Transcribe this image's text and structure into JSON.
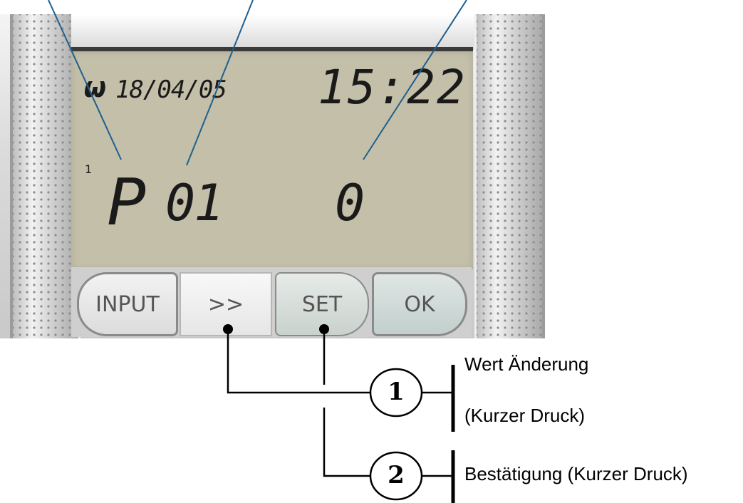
{
  "lcd": {
    "date": "18/04/05",
    "time": "15:22",
    "line_number": "1",
    "program_letter": "P",
    "program_number": "01",
    "value": "0"
  },
  "buttons": {
    "input_label": "INPUT",
    "next_label": ">>",
    "set_label": "SET",
    "ok_label": "OK"
  },
  "legend": {
    "marker_1": "1",
    "marker_2": "2",
    "step1_line1": "Wert Änderung",
    "step1_line2": "(Kurzer Druck)",
    "step2": "Bestätigung (Kurzer Druck)"
  },
  "colors": {
    "lcd_background": "#c3bfa9",
    "pointer_lines": "#1f5f8f"
  }
}
